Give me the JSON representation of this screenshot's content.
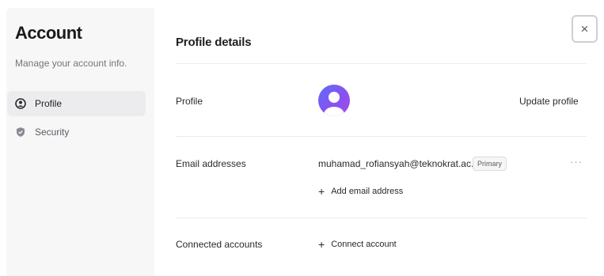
{
  "sidebar": {
    "title": "Account",
    "subtitle": "Manage your account info.",
    "items": [
      {
        "label": "Profile",
        "icon": "user-circle-icon",
        "active": true
      },
      {
        "label": "Security",
        "icon": "shield-icon",
        "active": false
      }
    ]
  },
  "main": {
    "title": "Profile details",
    "close_label": "×",
    "profile": {
      "label": "Profile",
      "action": "Update profile"
    },
    "email": {
      "label": "Email addresses",
      "address": "muhamad_rofiansyah@teknokrat.ac.id",
      "badge": "Primary",
      "more": "···",
      "add_label": "Add email address"
    },
    "connected": {
      "label": "Connected accounts",
      "add_label": "Connect account"
    }
  },
  "colors": {
    "avatar_gradient_start": "#5b6ef7",
    "avatar_gradient_end": "#a14fe6",
    "sidebar_bg": "#f7f7f8",
    "active_item_bg": "#ececee"
  }
}
